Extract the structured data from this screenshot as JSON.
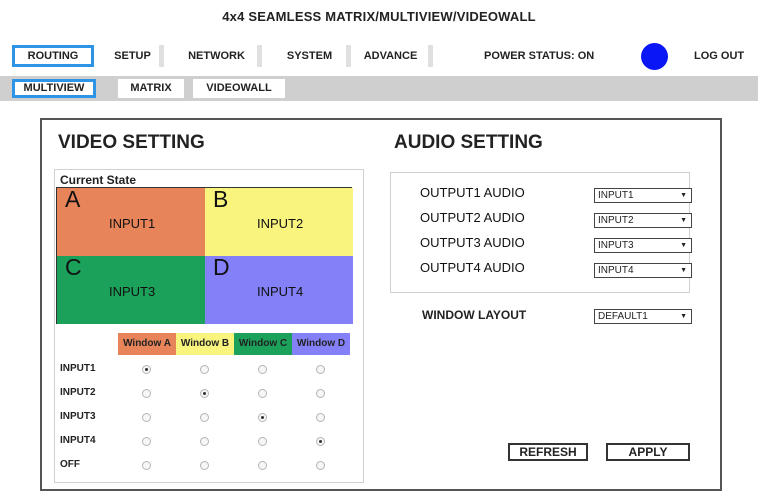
{
  "header": {
    "title": "4x4 SEAMLESS MATRIX/MULTIVIEW/VIDEOWALL"
  },
  "nav": {
    "items": [
      {
        "label": "ROUTING",
        "active": true
      },
      {
        "label": "SETUP",
        "active": false
      },
      {
        "label": "NETWORK",
        "active": false
      },
      {
        "label": "SYSTEM",
        "active": false
      },
      {
        "label": "ADVANCE",
        "active": false
      }
    ],
    "power_status": "POWER STATUS: ON",
    "power_color": "#0a16f5",
    "logout": "LOG OUT"
  },
  "subnav": {
    "items": [
      {
        "label": "MULTIVIEW",
        "active": true
      },
      {
        "label": "MATRIX",
        "active": false
      },
      {
        "label": "VIDEOWALL",
        "active": false
      }
    ]
  },
  "video": {
    "title": "VIDEO SETTING",
    "state_label": "Current State",
    "windows": [
      {
        "letter": "A",
        "input": "INPUT1",
        "color": "#e8845a"
      },
      {
        "letter": "B",
        "input": "INPUT2",
        "color": "#f8f47e"
      },
      {
        "letter": "C",
        "input": "INPUT3",
        "color": "#1ba15a"
      },
      {
        "letter": "D",
        "input": "INPUT4",
        "color": "#8480f8"
      }
    ],
    "window_headers": [
      "Window A",
      "Window B",
      "Window C",
      "Window D"
    ],
    "rows": [
      {
        "label": "INPUT1",
        "selected": [
          true,
          false,
          false,
          false
        ]
      },
      {
        "label": "INPUT2",
        "selected": [
          false,
          true,
          false,
          false
        ]
      },
      {
        "label": "INPUT3",
        "selected": [
          false,
          false,
          true,
          false
        ]
      },
      {
        "label": "INPUT4",
        "selected": [
          false,
          false,
          false,
          true
        ]
      },
      {
        "label": "OFF",
        "selected": [
          false,
          false,
          false,
          false
        ]
      }
    ]
  },
  "audio": {
    "title": "AUDIO SETTING",
    "outputs": [
      {
        "label": "OUTPUT1 AUDIO",
        "value": "INPUT1"
      },
      {
        "label": "OUTPUT2 AUDIO",
        "value": "INPUT2"
      },
      {
        "label": "OUTPUT3 AUDIO",
        "value": "INPUT3"
      },
      {
        "label": "OUTPUT4 AUDIO",
        "value": "INPUT4"
      }
    ],
    "window_layout_label": "WINDOW LAYOUT",
    "window_layout_value": "DEFAULT1"
  },
  "actions": {
    "refresh": "REFRESH",
    "apply": "APPLY"
  }
}
